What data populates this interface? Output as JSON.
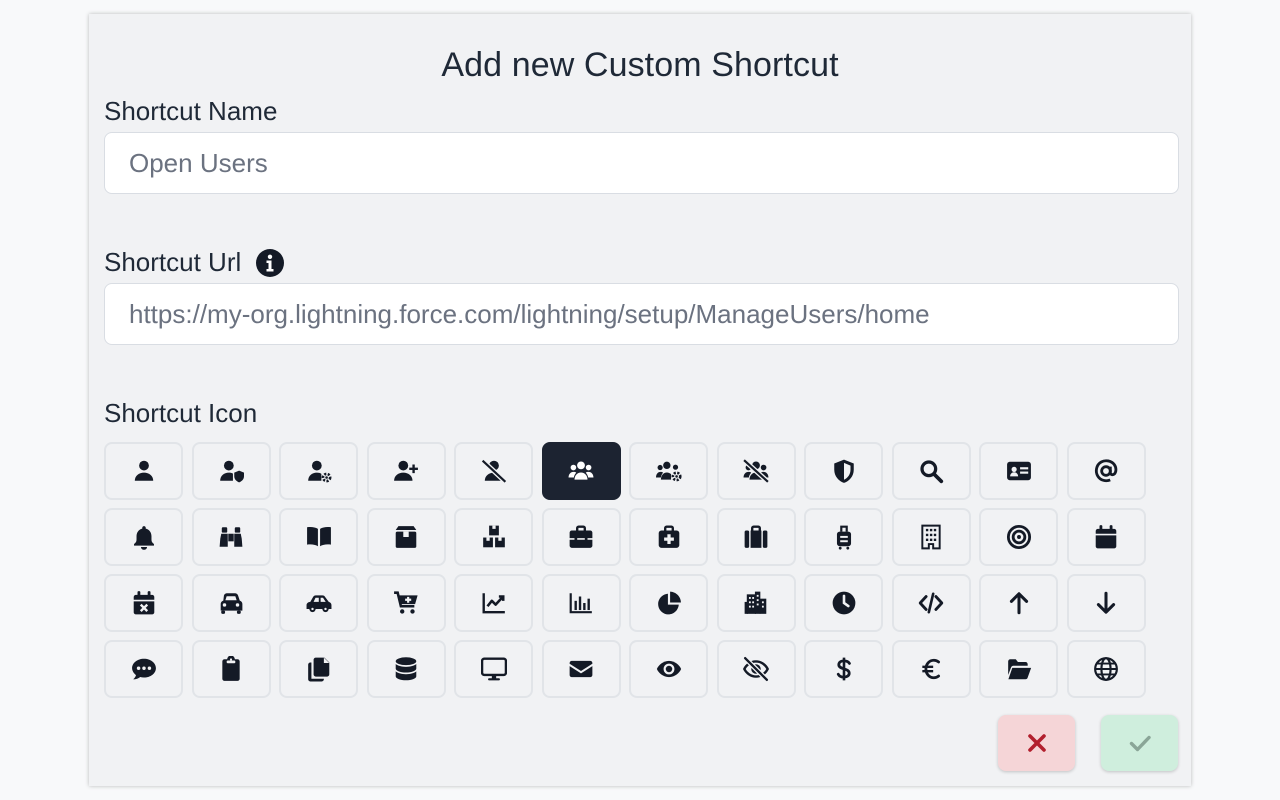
{
  "dialog": {
    "title": "Add new Custom Shortcut"
  },
  "form": {
    "name_label": "Shortcut Name",
    "name_placeholder": "Open Users",
    "url_label": "Shortcut Url",
    "url_placeholder": "https://my-org.lightning.force.com/lightning/setup/ManageUsers/home",
    "icon_label": "Shortcut Icon"
  },
  "icons": [
    {
      "name": "user-icon",
      "selected": false
    },
    {
      "name": "user-shield-icon",
      "selected": false
    },
    {
      "name": "user-gear-icon",
      "selected": false
    },
    {
      "name": "user-plus-icon",
      "selected": false
    },
    {
      "name": "user-slash-icon",
      "selected": false
    },
    {
      "name": "users-icon",
      "selected": true
    },
    {
      "name": "users-gear-icon",
      "selected": false
    },
    {
      "name": "users-slash-icon",
      "selected": false
    },
    {
      "name": "shield-icon",
      "selected": false
    },
    {
      "name": "search-icon",
      "selected": false
    },
    {
      "name": "id-card-icon",
      "selected": false
    },
    {
      "name": "at-icon",
      "selected": false
    },
    {
      "name": "bell-icon",
      "selected": false
    },
    {
      "name": "binoculars-icon",
      "selected": false
    },
    {
      "name": "book-open-icon",
      "selected": false
    },
    {
      "name": "box-icon",
      "selected": false
    },
    {
      "name": "boxes-icon",
      "selected": false
    },
    {
      "name": "toolbox-icon",
      "selected": false
    },
    {
      "name": "medical-kit-icon",
      "selected": false
    },
    {
      "name": "suitcase-icon",
      "selected": false
    },
    {
      "name": "luggage-icon",
      "selected": false
    },
    {
      "name": "building-icon",
      "selected": false
    },
    {
      "name": "bullseye-icon",
      "selected": false
    },
    {
      "name": "calendar-icon",
      "selected": false
    },
    {
      "name": "calendar-x-icon",
      "selected": false
    },
    {
      "name": "car-front-icon",
      "selected": false
    },
    {
      "name": "car-side-icon",
      "selected": false
    },
    {
      "name": "cart-plus-icon",
      "selected": false
    },
    {
      "name": "chart-line-icon",
      "selected": false
    },
    {
      "name": "chart-bar-icon",
      "selected": false
    },
    {
      "name": "chart-pie-icon",
      "selected": false
    },
    {
      "name": "city-icon",
      "selected": false
    },
    {
      "name": "clock-icon",
      "selected": false
    },
    {
      "name": "code-icon",
      "selected": false
    },
    {
      "name": "arrow-up-icon",
      "selected": false
    },
    {
      "name": "arrow-down-icon",
      "selected": false
    },
    {
      "name": "comment-dots-icon",
      "selected": false
    },
    {
      "name": "clipboard-icon",
      "selected": false
    },
    {
      "name": "copy-icon",
      "selected": false
    },
    {
      "name": "database-icon",
      "selected": false
    },
    {
      "name": "desktop-icon",
      "selected": false
    },
    {
      "name": "envelope-icon",
      "selected": false
    },
    {
      "name": "eye-icon",
      "selected": false
    },
    {
      "name": "eye-slash-icon",
      "selected": false
    },
    {
      "name": "dollar-icon",
      "selected": false
    },
    {
      "name": "euro-icon",
      "selected": false
    },
    {
      "name": "folder-open-icon",
      "selected": false
    },
    {
      "name": "globe-icon",
      "selected": false
    }
  ],
  "actions": {
    "cancel_icon": "x-icon",
    "confirm_icon": "check-icon"
  },
  "colors": {
    "selected_icon_bg": "#1c2331",
    "cancel_bg": "#f5d5d7",
    "cancel_fg": "#b21f2d",
    "confirm_bg": "#cfeedd",
    "confirm_fg": "#8aa597"
  }
}
